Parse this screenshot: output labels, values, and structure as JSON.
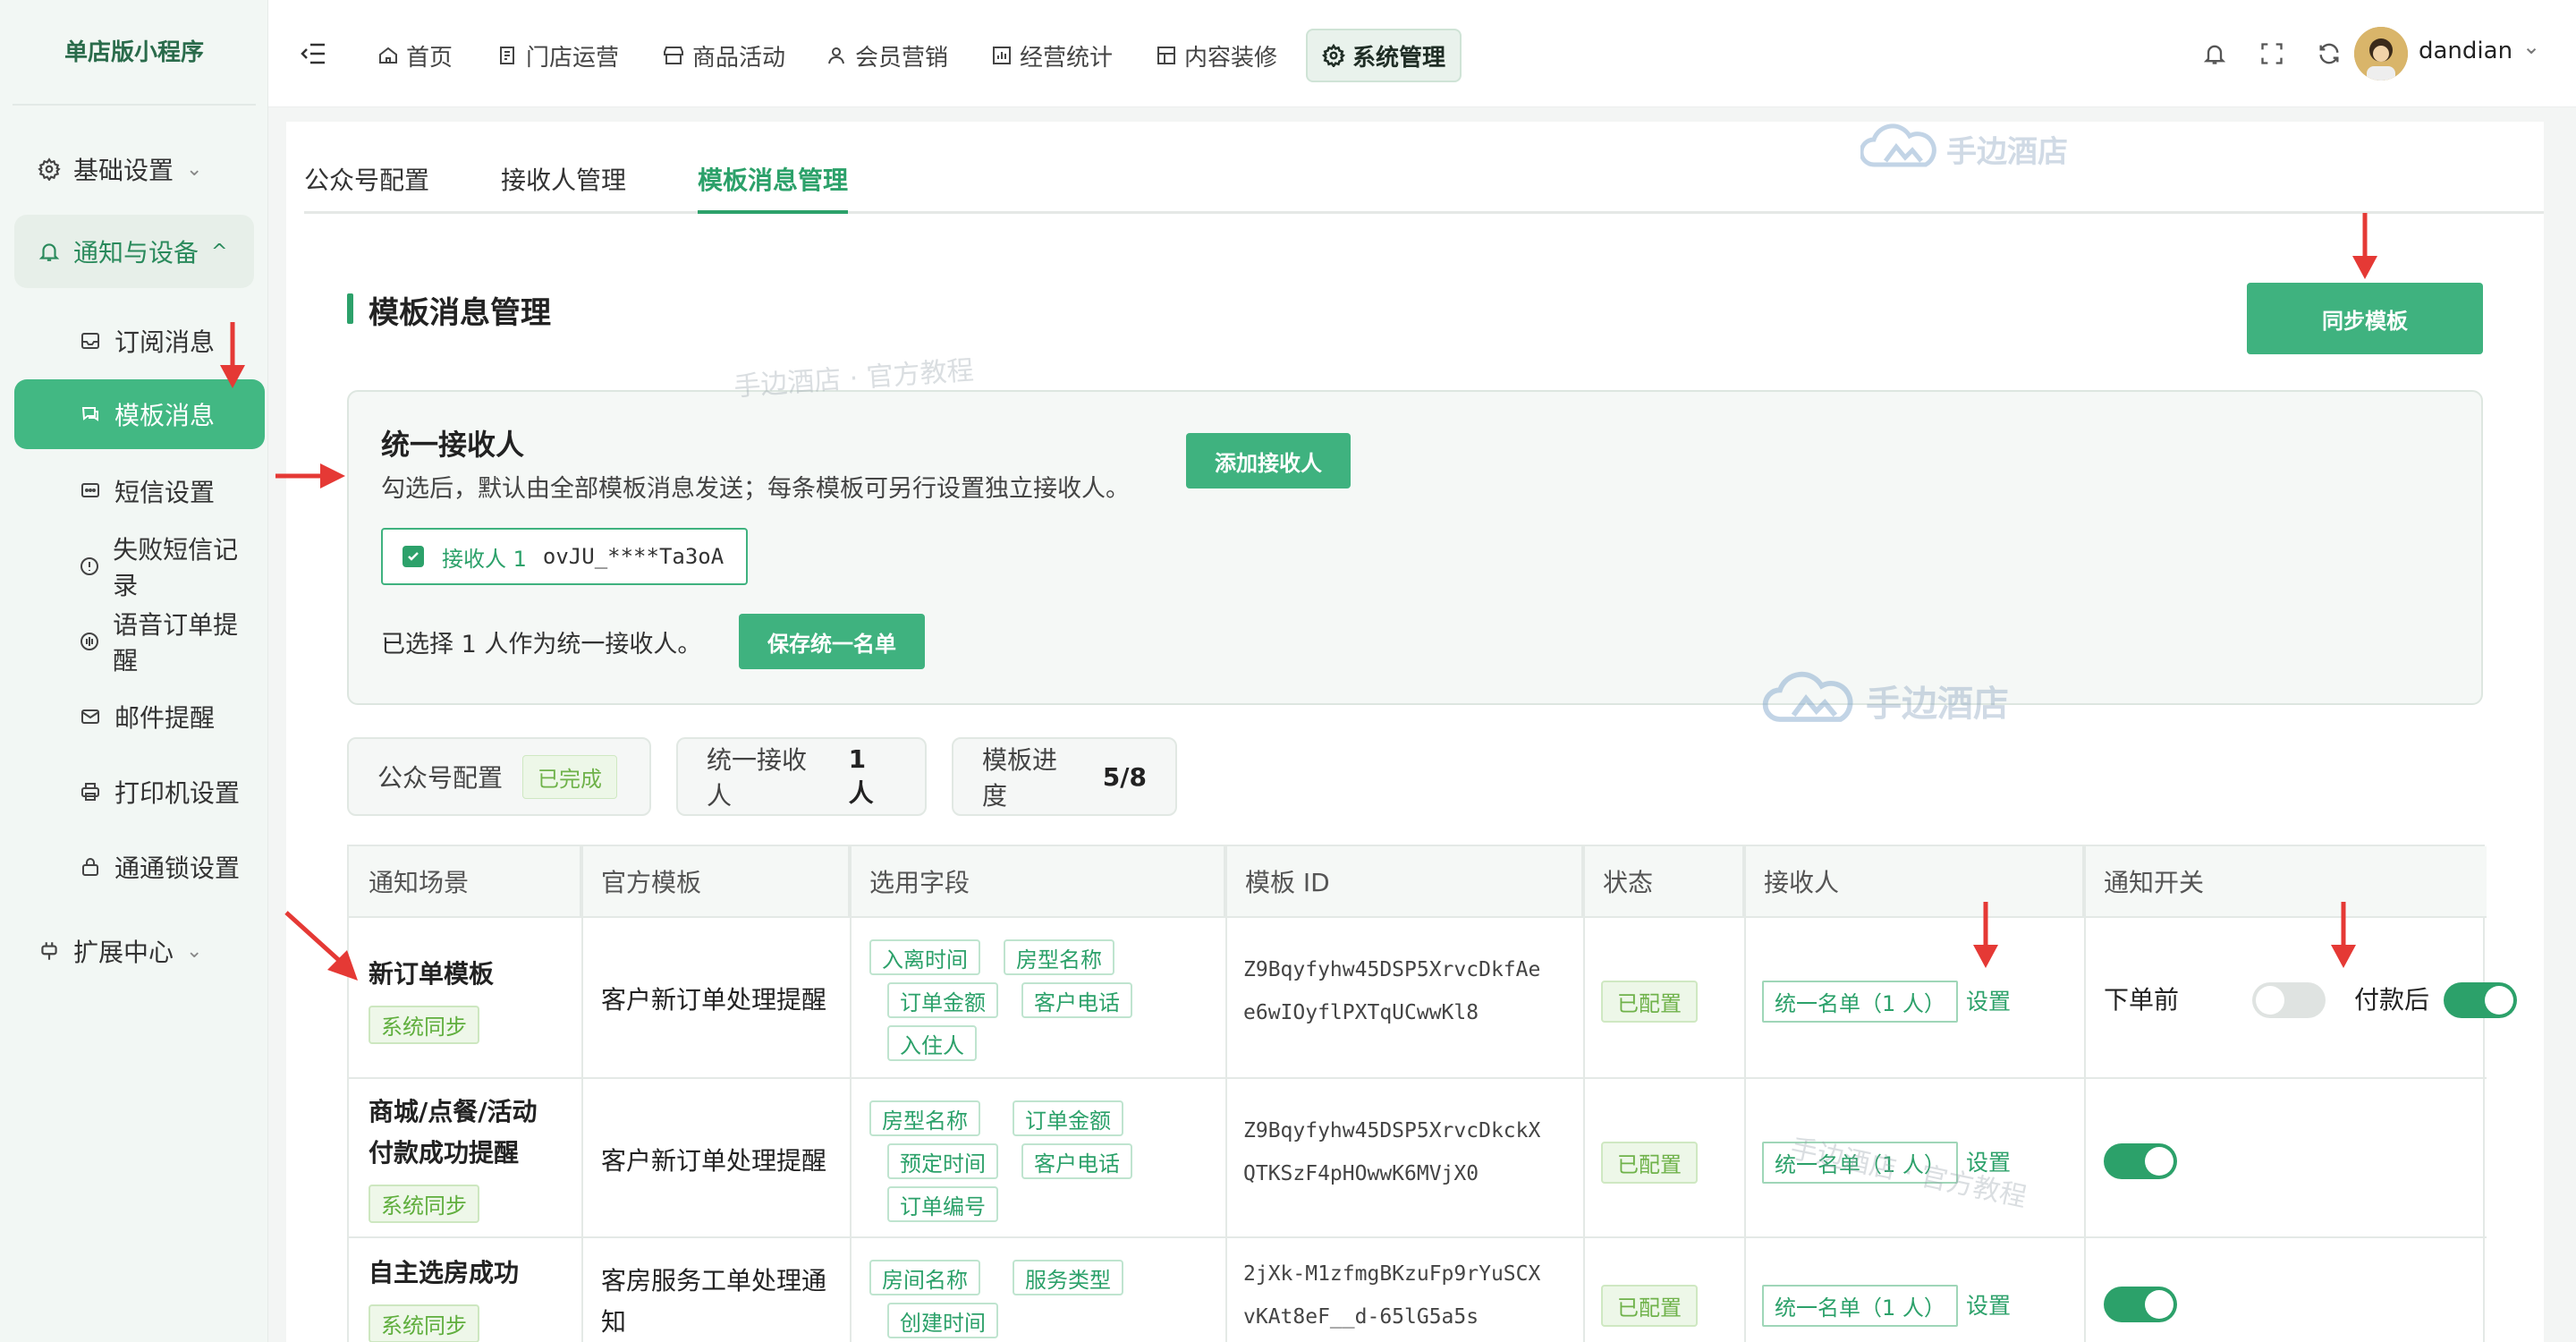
{
  "app": {
    "title": "单店版小程序"
  },
  "sidebar": {
    "items": [
      {
        "label": "基础设置",
        "icon": "gear-icon"
      },
      {
        "label": "通知与设备",
        "icon": "bell-icon"
      },
      {
        "label": "订阅消息",
        "icon": "inbox-icon"
      },
      {
        "label": "模板消息",
        "icon": "chat-icon"
      },
      {
        "label": "短信设置",
        "icon": "sms-icon"
      },
      {
        "label": "失败短信记录",
        "icon": "alert-icon"
      },
      {
        "label": "语音订单提醒",
        "icon": "voice-icon"
      },
      {
        "label": "邮件提醒",
        "icon": "mail-icon"
      },
      {
        "label": "打印机设置",
        "icon": "printer-icon"
      },
      {
        "label": "通通锁设置",
        "icon": "lock-icon"
      },
      {
        "label": "扩展中心",
        "icon": "plugin-icon"
      }
    ]
  },
  "topnav": {
    "items": [
      "首页",
      "门店运营",
      "商品活动",
      "会员营销",
      "经营统计",
      "内容装修",
      "系统管理"
    ],
    "active": "系统管理"
  },
  "user": {
    "name": "dandian"
  },
  "tabs": [
    "公众号配置",
    "接收人管理",
    "模板消息管理"
  ],
  "section": {
    "title": "模板消息管理",
    "sync_button": "同步模板"
  },
  "unified": {
    "title": "统一接收人",
    "desc": "勾选后，默认由全部模板消息发送；每条模板可另行设置独立接收人。",
    "add_button": "添加接收人",
    "receiver_label": "接收人 1",
    "receiver_id": "ovJU_****Ta3oA",
    "selected_text": "已选择 1 人作为统一接收人。",
    "save_button": "保存统一名单"
  },
  "stats": {
    "account_label": "公众号配置",
    "account_status": "已完成",
    "recv_label": "统一接收人",
    "recv_value": "1 人",
    "progress_label": "模板进度",
    "progress_value": "5/8"
  },
  "table": {
    "headers": [
      "通知场景",
      "官方模板",
      "选用字段",
      "模板 ID",
      "状态",
      "接收人",
      "通知开关"
    ],
    "rows": [
      {
        "scene": "新订单模板",
        "tag": "系统同步",
        "template": "客户新订单处理提醒",
        "fields": [
          "入离时间",
          "房型名称",
          "订单金额",
          "客户电话",
          "入住人"
        ],
        "id1": "Z9Bqyfyhw45DSP5XrvcDkfAe",
        "id2": "e6wIOyflPXTqUCwwKl8",
        "status": "已配置",
        "receiver": "统一名单（1 人）",
        "set": "设置",
        "sw1_label": "下单前",
        "sw1": false,
        "sw2_label": "付款后",
        "sw2": true
      },
      {
        "scene1": "商城/点餐/活动",
        "scene2": "付款成功提醒",
        "tag": "系统同步",
        "template": "客户新订单处理提醒",
        "fields": [
          "房型名称",
          "订单金额",
          "预定时间",
          "客户电话",
          "订单编号"
        ],
        "id1": "Z9Bqyfyhw45DSP5XrvcDkckX",
        "id2": "QTKSzF4pHOwwK6MVjX0",
        "status": "已配置",
        "receiver": "统一名单（1 人）",
        "set": "设置",
        "sw": true
      },
      {
        "scene": "自主选房成功",
        "tag": "系统同步",
        "template1": "客房服务工单处理通",
        "template2": "知",
        "fields": [
          "房间名称",
          "服务类型",
          "创建时间"
        ],
        "id1": "2jXk-M1zfmgBKzuFp9rYuSCX",
        "id2": "vKAt8eF__d-65lG5a5s",
        "status": "已配置",
        "receiver": "统一名单（1 人）",
        "set": "设置",
        "sw": true
      }
    ]
  },
  "watermark": {
    "brand": "手边酒店",
    "tutorial": "手边酒店 · 官方教程"
  },
  "colors": {
    "accent": "#2ca16a",
    "active_bg": "#42b883",
    "arrow": "#e53935"
  }
}
